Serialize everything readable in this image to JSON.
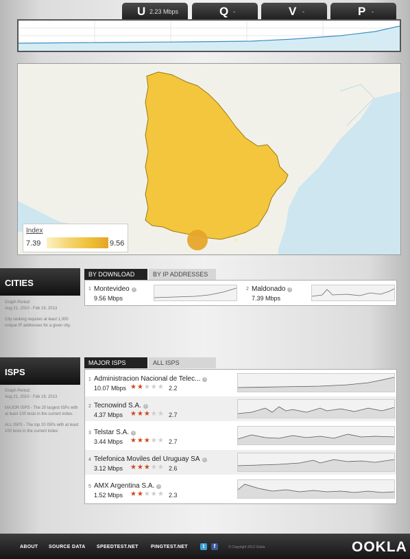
{
  "tabs": [
    {
      "letter": "U",
      "value": "2.23 Mbps"
    },
    {
      "letter": "Q",
      "value": "-"
    },
    {
      "letter": "V",
      "value": "-"
    },
    {
      "letter": "P",
      "value": "-"
    }
  ],
  "legend": {
    "title": "Index",
    "min": "7.39",
    "max": "9.56"
  },
  "cities": {
    "header": "CITIES",
    "graph_period_label": "Graph Period:",
    "graph_period": "Aug 21, 2010 - Feb 19, 2013",
    "note": "City ranking requires at least 1,000 unique IP addresses for a given city.",
    "tabs": [
      "BY DOWNLOAD",
      "BY IP ADDRESSES"
    ],
    "rows": [
      {
        "rank": "1",
        "name": "Montevideo",
        "speed": "9.56 Mbps"
      },
      {
        "rank": "2",
        "name": "Maldonado",
        "speed": "7.39 Mbps"
      }
    ]
  },
  "isps": {
    "header": "ISPS",
    "graph_period_label": "Graph Period:",
    "graph_period": "Aug 21, 2010 - Feb 19, 2013",
    "note_major": "MAJOR ISPS - The 20 largest ISPs with at least 100 tests in the current index.",
    "note_all": "ALL ISPS - The top 20 ISPs with at least 100 tests in the current index.",
    "tabs": [
      "MAJOR ISPS",
      "ALL ISPS"
    ],
    "rows": [
      {
        "rank": "1",
        "name": "Administracion Nacional de Telec...",
        "speed": "10.07 Mbps",
        "stars": 2,
        "rating": "2.2"
      },
      {
        "rank": "2",
        "name": "Tecnowind S.A.",
        "speed": "4.37 Mbps",
        "stars": 3,
        "rating": "2.7"
      },
      {
        "rank": "3",
        "name": "Telstar S.A.",
        "speed": "3.44 Mbps",
        "stars": 3,
        "rating": "2.7"
      },
      {
        "rank": "4",
        "name": "Telefonica Moviles del Uruguay SA",
        "speed": "3.12 Mbps",
        "stars": 3,
        "rating": "2.6"
      },
      {
        "rank": "5",
        "name": "AMX Argentina S.A.",
        "speed": "1.52 Mbps",
        "stars": 2,
        "rating": "2.3"
      }
    ]
  },
  "footer": {
    "links": [
      "ABOUT",
      "SOURCE DATA",
      "SPEEDTEST.NET",
      "PINGTEST.NET"
    ],
    "copyright": "© Copyright 2012 Ookla",
    "logo": "OOKLA"
  },
  "colors": {
    "accent": "#d2451c",
    "map_fill": "#f4c63d",
    "water": "#cde6ef"
  }
}
